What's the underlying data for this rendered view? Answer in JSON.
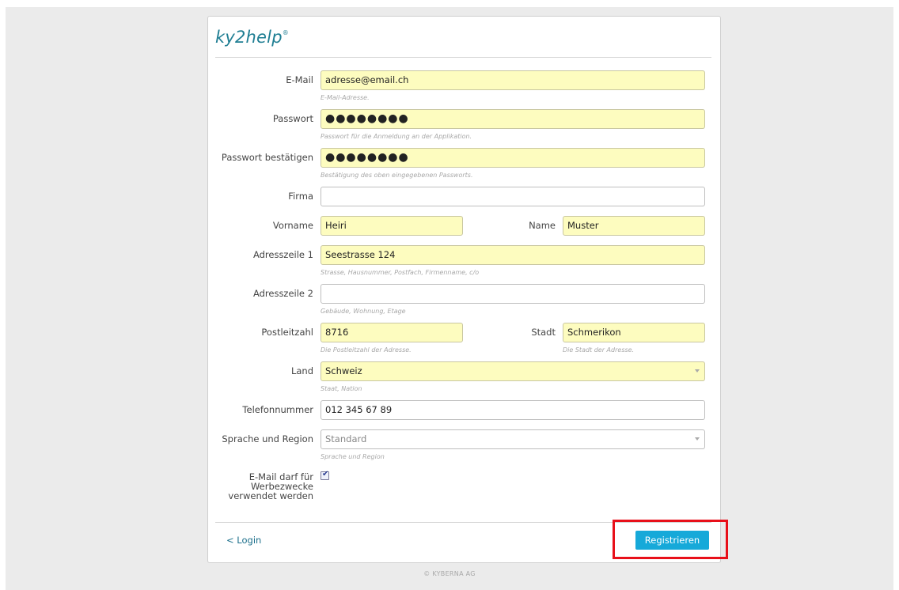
{
  "brand": {
    "logo_text": "ky2help",
    "logo_mark": "®"
  },
  "form": {
    "email": {
      "label": "E-Mail",
      "value": "adresse@email.ch",
      "hint": "E-Mail-Adresse."
    },
    "password": {
      "label": "Passwort",
      "value": "●●●●●●●●",
      "hint": "Passwort für die Anmeldung an der Applikation."
    },
    "password_confirm": {
      "label": "Passwort bestätigen",
      "value": "●●●●●●●●",
      "hint": "Bestätigung des oben eingegebenen Passworts."
    },
    "company": {
      "label": "Firma",
      "value": ""
    },
    "firstname": {
      "label": "Vorname",
      "value": "Heiri"
    },
    "lastname": {
      "label": "Name",
      "value": "Muster"
    },
    "address1": {
      "label": "Adresszeile 1",
      "value": "Seestrasse 124",
      "hint": "Strasse, Hausnummer, Postfach, Firmenname, c/o"
    },
    "address2": {
      "label": "Adresszeile 2",
      "value": "",
      "hint": "Gebäude, Wohnung, Etage"
    },
    "zip": {
      "label": "Postleitzahl",
      "value": "8716",
      "hint": "Die Postleitzahl der Adresse."
    },
    "city": {
      "label": "Stadt",
      "value": "Schmerikon",
      "hint": "Die Stadt der Adresse."
    },
    "country": {
      "label": "Land",
      "value": "Schweiz",
      "hint": "Staat, Nation"
    },
    "phone": {
      "label": "Telefonnummer",
      "value": "012 345 67 89"
    },
    "language": {
      "label": "Sprache und Region",
      "value": "Standard",
      "hint": "Sprache und Region"
    },
    "marketing": {
      "label_line1": "E-Mail darf für",
      "label_line2": "Werbezwecke",
      "label_line3": "verwendet werden",
      "checked": true,
      "mark": "✔"
    }
  },
  "actions": {
    "login_link": "< Login",
    "register_button": "Registrieren"
  },
  "colors": {
    "accent": "#16a9d9",
    "highlight": "#e8101a",
    "filled_field": "#fdfcbf",
    "brand": "#1f7e93"
  },
  "footer": {
    "copyright": "© KYBERNA AG"
  }
}
